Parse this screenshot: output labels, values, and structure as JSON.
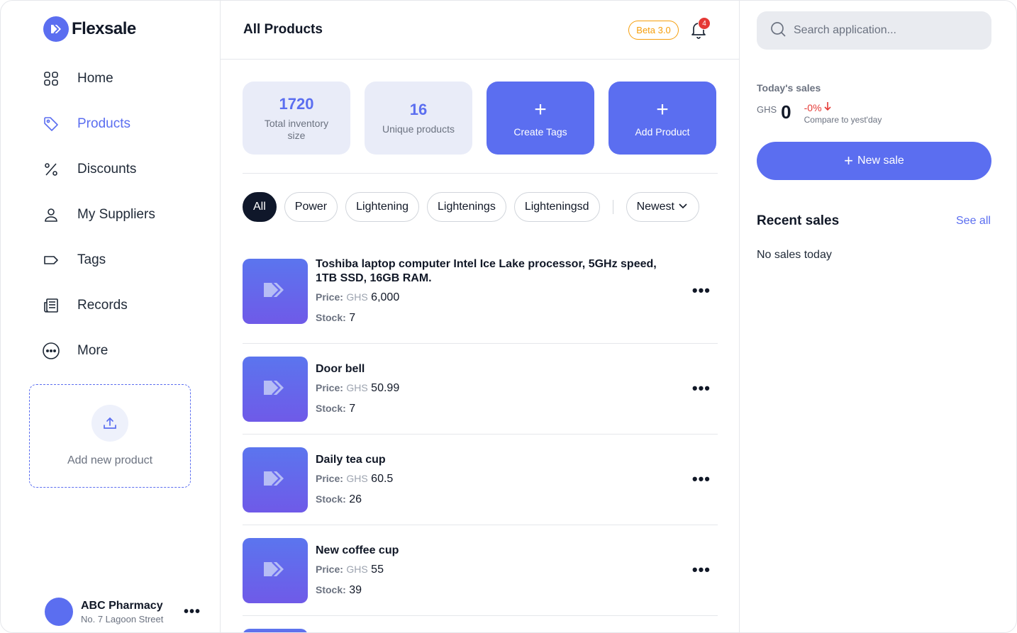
{
  "brand": {
    "name": "Flexsale"
  },
  "sidebar": {
    "items": [
      {
        "label": "Home",
        "icon": "grid-icon"
      },
      {
        "label": "Products",
        "icon": "tag-icon",
        "active": true
      },
      {
        "label": "Discounts",
        "icon": "percent-icon"
      },
      {
        "label": "My Suppliers",
        "icon": "user-icon"
      },
      {
        "label": "Tags",
        "icon": "label-icon"
      },
      {
        "label": "Records",
        "icon": "records-icon"
      },
      {
        "label": "More",
        "icon": "more-circle-icon"
      }
    ],
    "upload_label": "Add new product",
    "account": {
      "name": "ABC Pharmacy",
      "address": "No. 7 Lagoon Street"
    }
  },
  "header": {
    "title": "All Products",
    "beta": "Beta 3.0",
    "notification_count": "4"
  },
  "stats": {
    "inventory": {
      "value": "1720",
      "label": "Total inventory size"
    },
    "unique": {
      "value": "16",
      "label": "Unique products"
    }
  },
  "actions": {
    "create_tags": "Create Tags",
    "add_product": "Add Product",
    "plus": "+"
  },
  "filters": {
    "chips": [
      "All",
      "Power",
      "Lightening",
      "Lightenings",
      "Lighteningsd"
    ],
    "active": "All",
    "sort": "Newest"
  },
  "product_meta": {
    "price_label": "Price:",
    "stock_label": "Stock:",
    "currency": "GHS"
  },
  "products": [
    {
      "name": "Toshiba laptop computer Intel Ice Lake processor, 5GHz speed, 1TB SSD, 16GB RAM.",
      "price": "6,000",
      "stock": "7"
    },
    {
      "name": "Door bell",
      "price": "50.99",
      "stock": "7"
    },
    {
      "name": "Daily tea cup",
      "price": "60.5",
      "stock": "26"
    },
    {
      "name": "New coffee cup",
      "price": "55",
      "stock": "39"
    }
  ],
  "right_panel": {
    "search_placeholder": "Search application...",
    "sales_heading": "Today's sales",
    "currency": "GHS",
    "amount": "0",
    "change": "-0%",
    "change_note": "Compare to yest'day",
    "new_sale": "New sale",
    "recent_title": "Recent sales",
    "see_all": "See all",
    "no_sales": "No sales today"
  },
  "colors": {
    "accent": "#5b6ef0",
    "warning": "#f59e0b",
    "danger": "#e53935",
    "dark": "#0f172a"
  }
}
